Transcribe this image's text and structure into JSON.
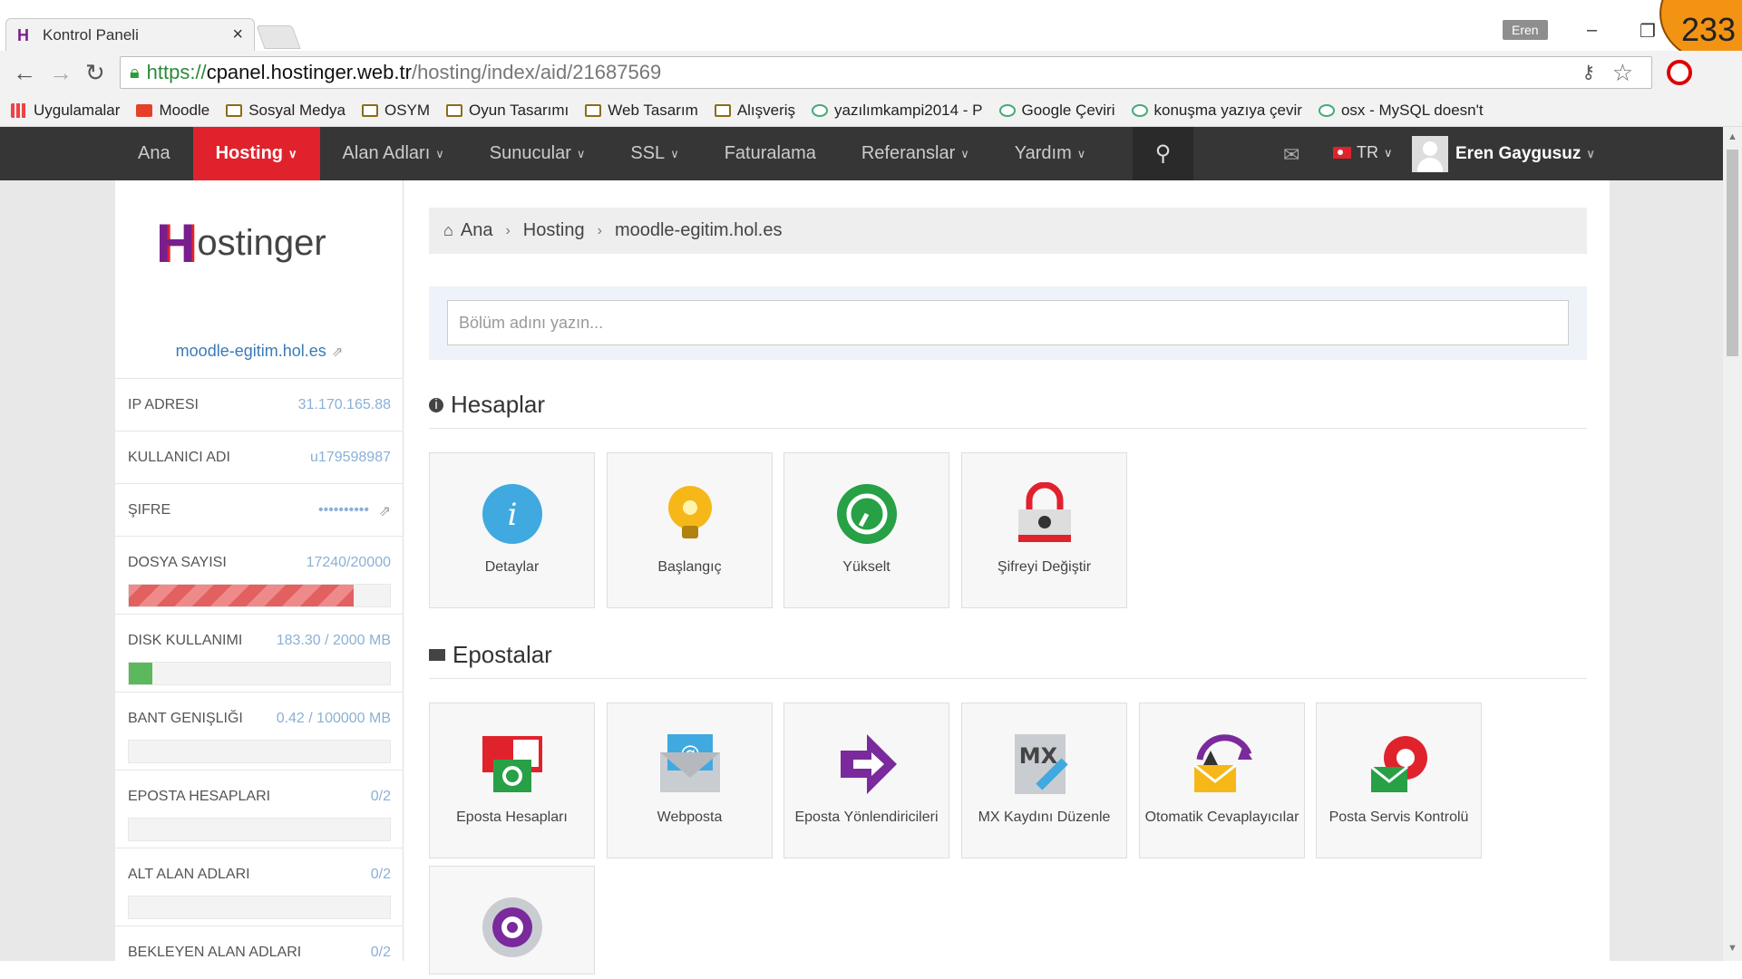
{
  "browser": {
    "tab_title": "Kontrol Paneli",
    "tab_close": "×",
    "user_badge": "Eren",
    "counter": "233",
    "url_scheme": "https://",
    "url_host": "cpanel.hostinger.web.tr",
    "url_path": "/hosting/index/aid/21687569",
    "bookmarks": [
      "Uygulamalar",
      "Moodle",
      "Sosyal Medya",
      "OSYM",
      "Oyun Tasarımı",
      "Web Tasarım",
      "Alışveriş",
      "yazılımkampi2014 - P",
      "Google Çeviri",
      "konuşma yazıya çevir",
      "osx - MySQL doesn't"
    ]
  },
  "nav": {
    "items": [
      "Ana",
      "Hosting",
      "Alan Adları",
      "Sunucular",
      "SSL",
      "Faturalama",
      "Referanslar",
      "Yardım"
    ],
    "lang": "TR",
    "user": "Eren Gaygusuz"
  },
  "sidebar": {
    "logo": "ostinger",
    "domain": "moodle-egitim.hol.es",
    "rows": [
      {
        "label": "IP ADRESI",
        "value": "31.170.165.88"
      },
      {
        "label": "KULLANICI ADI",
        "value": "u179598987"
      },
      {
        "label": "ŞIFRE",
        "value": "••••••••••"
      },
      {
        "label": "DOSYA SAYISI",
        "value": "17240/20000",
        "fill": 0.862
      },
      {
        "label": "DISK KULLANIMI",
        "value": "183.30 / 2000 MB",
        "fill": 0.0917
      },
      {
        "label": "BANT GENIŞLIĞI",
        "value": "0.42 / 100000 MB",
        "fill": 0
      },
      {
        "label": "EPOSTA HESAPLARI",
        "value": "0/2",
        "fill": 0
      },
      {
        "label": "ALT ALAN ADLARI",
        "value": "0/2",
        "fill": 0
      },
      {
        "label": "BEKLEYEN ALAN ADLARI",
        "value": "0/2"
      }
    ]
  },
  "main": {
    "breadcrumb": [
      "Ana",
      "Hosting",
      "moodle-egitim.hol.es"
    ],
    "search_placeholder": "Bölüm adını yazın...",
    "sections": [
      {
        "title": "Hesaplar",
        "cards": [
          "Detaylar",
          "Başlangıç",
          "Yükselt",
          "Şifreyi Değiştir"
        ]
      },
      {
        "title": "Epostalar",
        "cards": [
          "Eposta Hesapları",
          "Webposta",
          "Eposta Yönlendiricileri",
          "MX Kaydını Düzenle",
          "Otomatik Cevaplayıcılar",
          "Posta Servis Kontrolü",
          ""
        ]
      }
    ]
  },
  "colors": {
    "accent": "#e0222d",
    "navbar": "#363636",
    "link": "#3a7ab8",
    "brand": "#7a1e8c"
  }
}
